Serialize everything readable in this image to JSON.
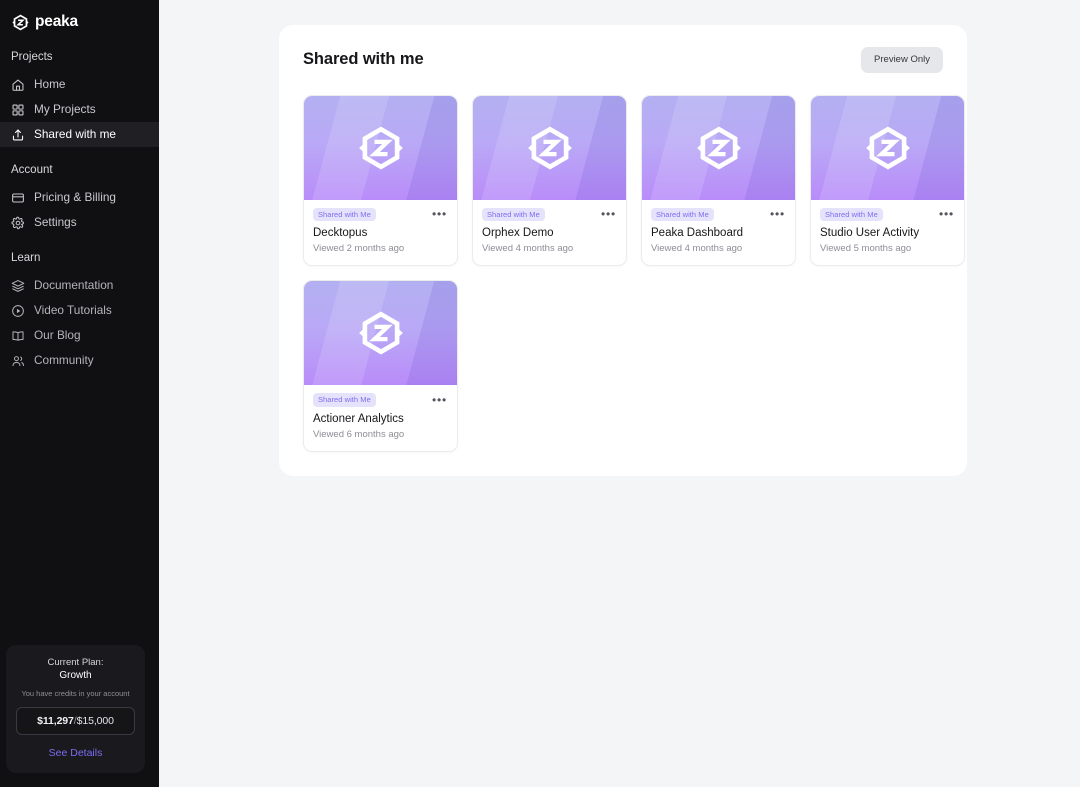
{
  "brand": {
    "name": "peaka",
    "logo_icon": "peaka-hex-logo-icon"
  },
  "sidebar": {
    "sections": [
      {
        "title": "Projects",
        "items": [
          {
            "label": "Home",
            "icon": "home-icon",
            "active": false
          },
          {
            "label": "My Projects",
            "icon": "grid-icon",
            "active": false
          },
          {
            "label": "Shared with me",
            "icon": "share-upload-icon",
            "active": true
          }
        ]
      },
      {
        "title": "Account",
        "items": [
          {
            "label": "Pricing & Billing",
            "icon": "credit-card-icon",
            "active": false
          },
          {
            "label": "Settings",
            "icon": "gear-icon",
            "active": false
          }
        ]
      },
      {
        "title": "Learn",
        "items": [
          {
            "label": "Documentation",
            "icon": "layers-icon",
            "active": false
          },
          {
            "label": "Video Tutorials",
            "icon": "play-circle-icon",
            "active": false
          },
          {
            "label": "Our Blog",
            "icon": "book-open-icon",
            "active": false
          },
          {
            "label": "Community",
            "icon": "users-icon",
            "active": false
          }
        ]
      }
    ],
    "plan_card": {
      "label": "Current Plan:",
      "plan_name": "Growth",
      "credits_note": "You have credits in your account",
      "credits_used": "$11,297",
      "credits_separator": "/",
      "credits_total": "$15,000",
      "details_link": "See Details"
    }
  },
  "main": {
    "title": "Shared with me",
    "preview_button": "Preview Only",
    "projects": [
      {
        "name": "Decktopus",
        "badge": "Shared with Me",
        "viewed": "Viewed 2 months ago",
        "menu": "•••"
      },
      {
        "name": "Orphex Demo",
        "badge": "Shared with Me",
        "viewed": "Viewed 4 months ago",
        "menu": "•••"
      },
      {
        "name": "Peaka Dashboard",
        "badge": "Shared with Me",
        "viewed": "Viewed 4 months ago",
        "menu": "•••"
      },
      {
        "name": "Studio User Activity",
        "badge": "Shared with Me",
        "viewed": "Viewed 5 months ago",
        "menu": "•••"
      },
      {
        "name": "Actioner Analytics",
        "badge": "Shared with Me",
        "viewed": "Viewed 6 months ago",
        "menu": "•••"
      }
    ]
  },
  "colors": {
    "sidebar_bg": "#101012",
    "accent_purple": "#7c6df2",
    "badge_bg": "#e5e2fb",
    "page_bg": "#f4f5f7",
    "panel_bg": "#ffffff"
  }
}
